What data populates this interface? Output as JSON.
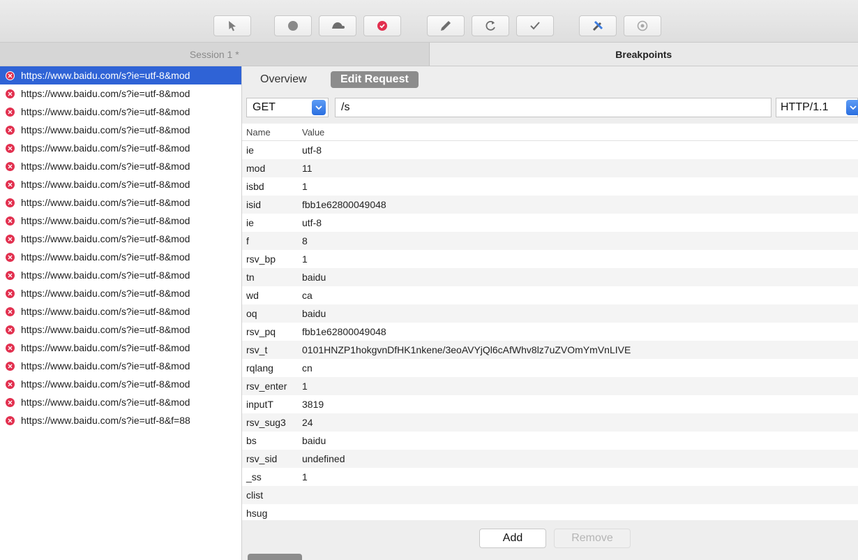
{
  "toolbar": {
    "buttons": [
      {
        "name": "select-tool-button",
        "icon": "pointer-icon"
      },
      {
        "name": "record-button",
        "icon": "record-icon"
      },
      {
        "name": "throttle-button",
        "icon": "turtle-icon"
      },
      {
        "name": "breakpoints-button",
        "icon": "breakpoint-icon"
      },
      {
        "name": "edit-button",
        "icon": "pen-icon"
      },
      {
        "name": "repeat-button",
        "icon": "refresh-icon"
      },
      {
        "name": "validate-button",
        "icon": "check-icon"
      },
      {
        "name": "tools-button",
        "icon": "tools-icon"
      },
      {
        "name": "settings-button",
        "icon": "gear-icon"
      }
    ],
    "accent_color": "#e2304f"
  },
  "session_tabs": [
    {
      "label": "Session 1 *",
      "active": false
    },
    {
      "label": "Breakpoints",
      "active": true
    }
  ],
  "requests": [
    "https://www.baidu.com/s?ie=utf-8&mod",
    "https://www.baidu.com/s?ie=utf-8&mod",
    "https://www.baidu.com/s?ie=utf-8&mod",
    "https://www.baidu.com/s?ie=utf-8&mod",
    "https://www.baidu.com/s?ie=utf-8&mod",
    "https://www.baidu.com/s?ie=utf-8&mod",
    "https://www.baidu.com/s?ie=utf-8&mod",
    "https://www.baidu.com/s?ie=utf-8&mod",
    "https://www.baidu.com/s?ie=utf-8&mod",
    "https://www.baidu.com/s?ie=utf-8&mod",
    "https://www.baidu.com/s?ie=utf-8&mod",
    "https://www.baidu.com/s?ie=utf-8&mod",
    "https://www.baidu.com/s?ie=utf-8&mod",
    "https://www.baidu.com/s?ie=utf-8&mod",
    "https://www.baidu.com/s?ie=utf-8&mod",
    "https://www.baidu.com/s?ie=utf-8&mod",
    "https://www.baidu.com/s?ie=utf-8&mod",
    "https://www.baidu.com/s?ie=utf-8&mod",
    "https://www.baidu.com/s?ie=utf-8&mod",
    "https://www.baidu.com/s?ie=utf-8&f=88"
  ],
  "selected_index": 0,
  "detail": {
    "tabs": {
      "overview": "Overview",
      "edit_request": "Edit Request"
    },
    "method": "GET",
    "path": "/s",
    "version": "HTTP/1.1",
    "columns": {
      "name": "Name",
      "value": "Value"
    },
    "params": [
      {
        "name": "ie",
        "value": "utf-8"
      },
      {
        "name": "mod",
        "value": "11"
      },
      {
        "name": "isbd",
        "value": "1"
      },
      {
        "name": "isid",
        "value": "fbb1e62800049048"
      },
      {
        "name": "ie",
        "value": "utf-8"
      },
      {
        "name": "f",
        "value": "8"
      },
      {
        "name": "rsv_bp",
        "value": "1"
      },
      {
        "name": "tn",
        "value": "baidu"
      },
      {
        "name": "wd",
        "value": "ca"
      },
      {
        "name": "oq",
        "value": "baidu"
      },
      {
        "name": "rsv_pq",
        "value": "fbb1e62800049048"
      },
      {
        "name": "rsv_t",
        "value": "0101HNZP1hokgvnDfHK1nkene/3eoAVYjQl6cAfWhv8lz7uZVOmYmVnLIVE"
      },
      {
        "name": "rqlang",
        "value": "cn"
      },
      {
        "name": "rsv_enter",
        "value": "1"
      },
      {
        "name": "inputT",
        "value": "3819"
      },
      {
        "name": "rsv_sug3",
        "value": "24"
      },
      {
        "name": "bs",
        "value": "baidu"
      },
      {
        "name": "rsv_sid",
        "value": "undefined"
      },
      {
        "name": "_ss",
        "value": "1"
      },
      {
        "name": "clist",
        "value": ""
      },
      {
        "name": "hsug",
        "value": ""
      }
    ],
    "add_label": "Add",
    "remove_label": "Remove"
  }
}
